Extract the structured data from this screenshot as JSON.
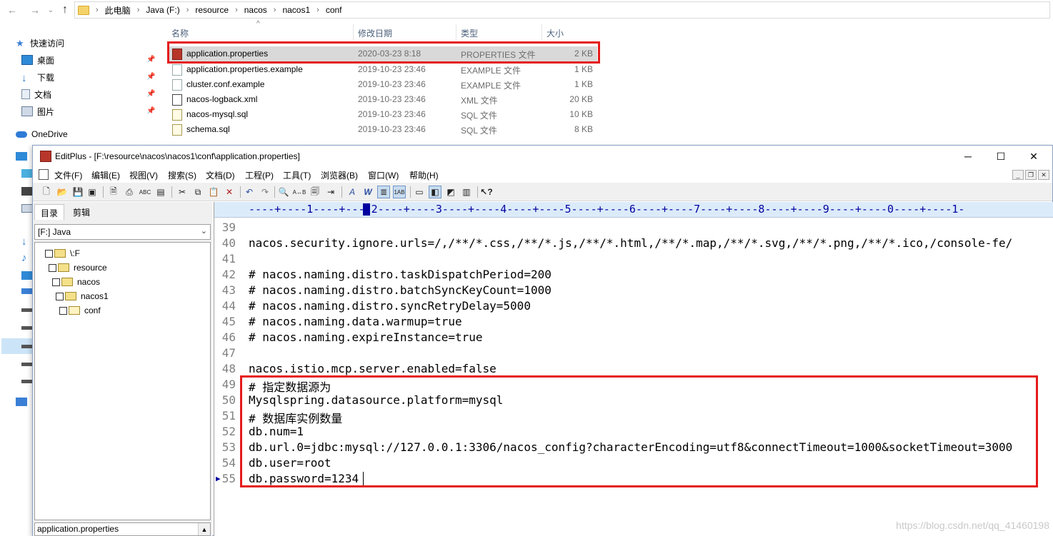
{
  "explorer": {
    "breadcrumbs": [
      "此电脑",
      "Java (F:)",
      "resource",
      "nacos",
      "nacos1",
      "conf"
    ],
    "nav": {
      "quick_access": "快速访问",
      "items": [
        "桌面",
        "下载",
        "文档",
        "图片"
      ],
      "onedrive": "OneDrive"
    },
    "columns": {
      "name": "名称",
      "date": "修改日期",
      "type": "类型",
      "size": "大小"
    },
    "files": [
      {
        "name": "application.properties",
        "date": "2020-03-23 8:18",
        "type": "PROPERTIES 文件",
        "size": "2 KB"
      },
      {
        "name": "application.properties.example",
        "date": "2019-10-23 23:46",
        "type": "EXAMPLE 文件",
        "size": "1 KB"
      },
      {
        "name": "cluster.conf.example",
        "date": "2019-10-23 23:46",
        "type": "EXAMPLE 文件",
        "size": "1 KB"
      },
      {
        "name": "nacos-logback.xml",
        "date": "2019-10-23 23:46",
        "type": "XML 文件",
        "size": "20 KB"
      },
      {
        "name": "nacos-mysql.sql",
        "date": "2019-10-23 23:46",
        "type": "SQL 文件",
        "size": "10 KB"
      },
      {
        "name": "schema.sql",
        "date": "2019-10-23 23:46",
        "type": "SQL 文件",
        "size": "8 KB"
      }
    ]
  },
  "editplus": {
    "title": "EditPlus - [F:\\resource\\nacos\\nacos1\\conf\\application.properties]",
    "menu": [
      "文件(F)",
      "编辑(E)",
      "视图(V)",
      "搜索(S)",
      "文档(D)",
      "工程(P)",
      "工具(T)",
      "浏览器(B)",
      "窗口(W)",
      "帮助(H)"
    ],
    "pane_tabs": [
      "目录",
      "剪辑"
    ],
    "drive": "[F:] Java",
    "tree": [
      "\\:F",
      "resource",
      "nacos",
      "nacos1",
      "conf"
    ],
    "file_filter": "application.properties",
    "ruler": "----+----1----+----2----+----3----+----4----+----5----+----6----+----7----+----8----+----9----+----0----+----1-",
    "lines": [
      {
        "n": "39",
        "text": ""
      },
      {
        "n": "40",
        "text": "nacos.security.ignore.urls=/,/**/*.css,/**/*.js,/**/*.html,/**/*.map,/**/*.svg,/**/*.png,/**/*.ico,/console-fe/"
      },
      {
        "n": "41",
        "text": ""
      },
      {
        "n": "42",
        "text": "# nacos.naming.distro.taskDispatchPeriod=200"
      },
      {
        "n": "43",
        "text": "# nacos.naming.distro.batchSyncKeyCount=1000"
      },
      {
        "n": "44",
        "text": "# nacos.naming.distro.syncRetryDelay=5000"
      },
      {
        "n": "45",
        "text": "# nacos.naming.data.warmup=true"
      },
      {
        "n": "46",
        "text": "# nacos.naming.expireInstance=true"
      },
      {
        "n": "47",
        "text": ""
      },
      {
        "n": "48",
        "text": "nacos.istio.mcp.server.enabled=false"
      },
      {
        "n": "49",
        "text": "# 指定数据源为"
      },
      {
        "n": "50",
        "text": "Mysqlspring.datasource.platform=mysql"
      },
      {
        "n": "51",
        "text": "# 数据库实例数量"
      },
      {
        "n": "52",
        "text": "db.num=1"
      },
      {
        "n": "53",
        "text": "db.url.0=jdbc:mysql://127.0.0.1:3306/nacos_config?characterEncoding=utf8&connectTimeout=1000&socketTimeout=3000"
      },
      {
        "n": "54",
        "text": "db.user=root"
      },
      {
        "n": "55",
        "text": "db.password=1234"
      }
    ],
    "watermark": "https://blog.csdn.net/qq_41460198"
  },
  "colors": {
    "highlight": "#e51b1b",
    "ruler_bg": "#dcebfa",
    "selected_row": "#d9d9d9"
  }
}
